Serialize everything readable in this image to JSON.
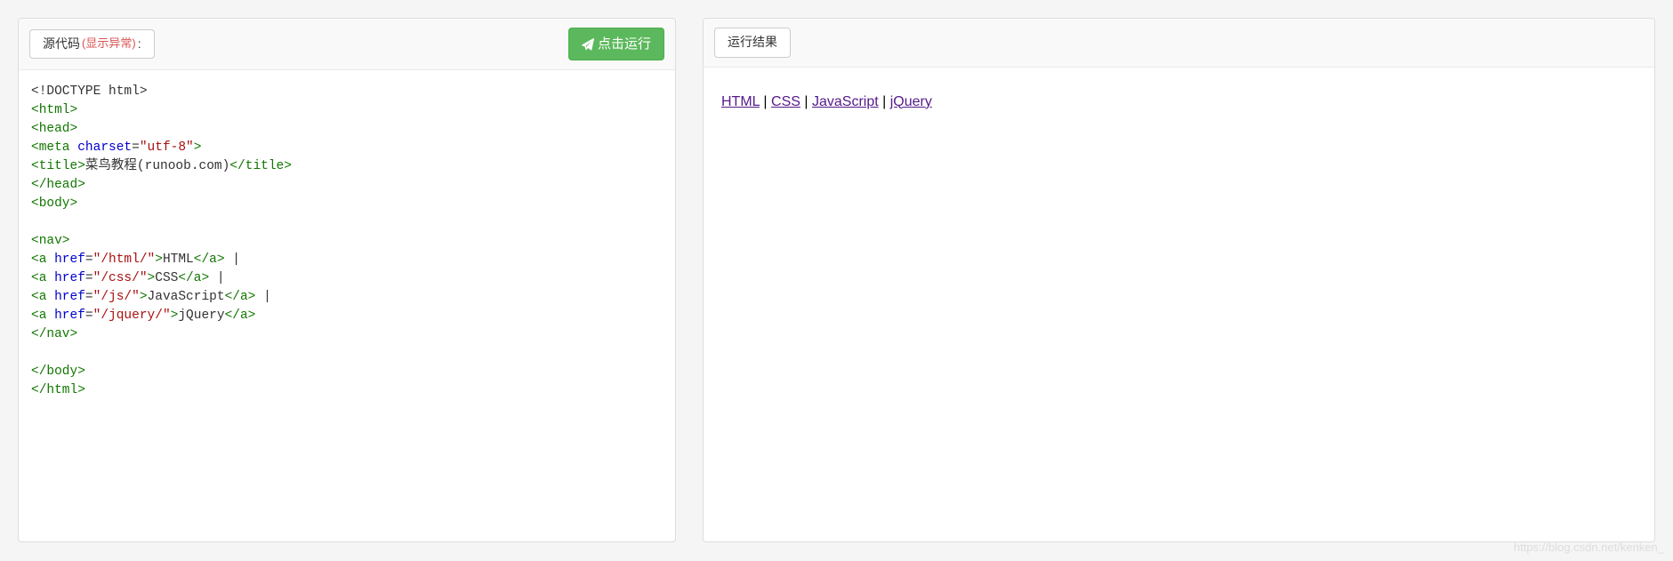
{
  "left": {
    "source_label_prefix": "源代码",
    "source_label_toggle": "显示异常",
    "run_button": "点击运行",
    "code_lines": [
      {
        "parts": [
          {
            "t": "txt",
            "v": "<!DOCTYPE html>"
          }
        ]
      },
      {
        "parts": [
          {
            "t": "tag",
            "v": "<html>"
          }
        ]
      },
      {
        "parts": [
          {
            "t": "tag",
            "v": "<head>"
          }
        ]
      },
      {
        "parts": [
          {
            "t": "tag",
            "v": "<meta "
          },
          {
            "t": "attr",
            "v": "charset"
          },
          {
            "t": "txt",
            "v": "="
          },
          {
            "t": "str",
            "v": "\"utf-8\""
          },
          {
            "t": "tag",
            "v": ">"
          }
        ]
      },
      {
        "parts": [
          {
            "t": "tag",
            "v": "<title>"
          },
          {
            "t": "txt",
            "v": "菜鸟教程(runoob.com)"
          },
          {
            "t": "tag",
            "v": "</title>"
          }
        ]
      },
      {
        "parts": [
          {
            "t": "tag",
            "v": "</head>"
          }
        ]
      },
      {
        "parts": [
          {
            "t": "tag",
            "v": "<body>"
          }
        ]
      },
      {
        "parts": [
          {
            "t": "txt",
            "v": ""
          }
        ]
      },
      {
        "parts": [
          {
            "t": "tag",
            "v": "<nav>"
          }
        ]
      },
      {
        "parts": [
          {
            "t": "tag",
            "v": "<a "
          },
          {
            "t": "attr",
            "v": "href"
          },
          {
            "t": "txt",
            "v": "="
          },
          {
            "t": "str",
            "v": "\"/html/\""
          },
          {
            "t": "tag",
            "v": ">"
          },
          {
            "t": "txt",
            "v": "HTML"
          },
          {
            "t": "tag",
            "v": "</a>"
          },
          {
            "t": "txt",
            "v": " |"
          }
        ]
      },
      {
        "parts": [
          {
            "t": "tag",
            "v": "<a "
          },
          {
            "t": "attr",
            "v": "href"
          },
          {
            "t": "txt",
            "v": "="
          },
          {
            "t": "str",
            "v": "\"/css/\""
          },
          {
            "t": "tag",
            "v": ">"
          },
          {
            "t": "txt",
            "v": "CSS"
          },
          {
            "t": "tag",
            "v": "</a>"
          },
          {
            "t": "txt",
            "v": " |"
          }
        ]
      },
      {
        "parts": [
          {
            "t": "tag",
            "v": "<a "
          },
          {
            "t": "attr",
            "v": "href"
          },
          {
            "t": "txt",
            "v": "="
          },
          {
            "t": "str",
            "v": "\"/js/\""
          },
          {
            "t": "tag",
            "v": ">"
          },
          {
            "t": "txt",
            "v": "JavaScript"
          },
          {
            "t": "tag",
            "v": "</a>"
          },
          {
            "t": "txt",
            "v": " |"
          }
        ]
      },
      {
        "parts": [
          {
            "t": "tag",
            "v": "<a "
          },
          {
            "t": "attr",
            "v": "href"
          },
          {
            "t": "txt",
            "v": "="
          },
          {
            "t": "str",
            "v": "\"/jquery/\""
          },
          {
            "t": "tag",
            "v": ">"
          },
          {
            "t": "txt",
            "v": "jQuery"
          },
          {
            "t": "tag",
            "v": "</a>"
          }
        ]
      },
      {
        "parts": [
          {
            "t": "tag",
            "v": "</nav>"
          }
        ]
      },
      {
        "parts": [
          {
            "t": "txt",
            "v": ""
          }
        ]
      },
      {
        "parts": [
          {
            "t": "tag",
            "v": "</body>"
          }
        ]
      },
      {
        "parts": [
          {
            "t": "tag",
            "v": "</html>"
          }
        ]
      }
    ]
  },
  "right": {
    "result_label": "运行结果",
    "links": [
      "HTML",
      "CSS",
      "JavaScript",
      "jQuery"
    ],
    "separator": " | "
  },
  "watermark": "https://blog.csdn.net/kenken_"
}
